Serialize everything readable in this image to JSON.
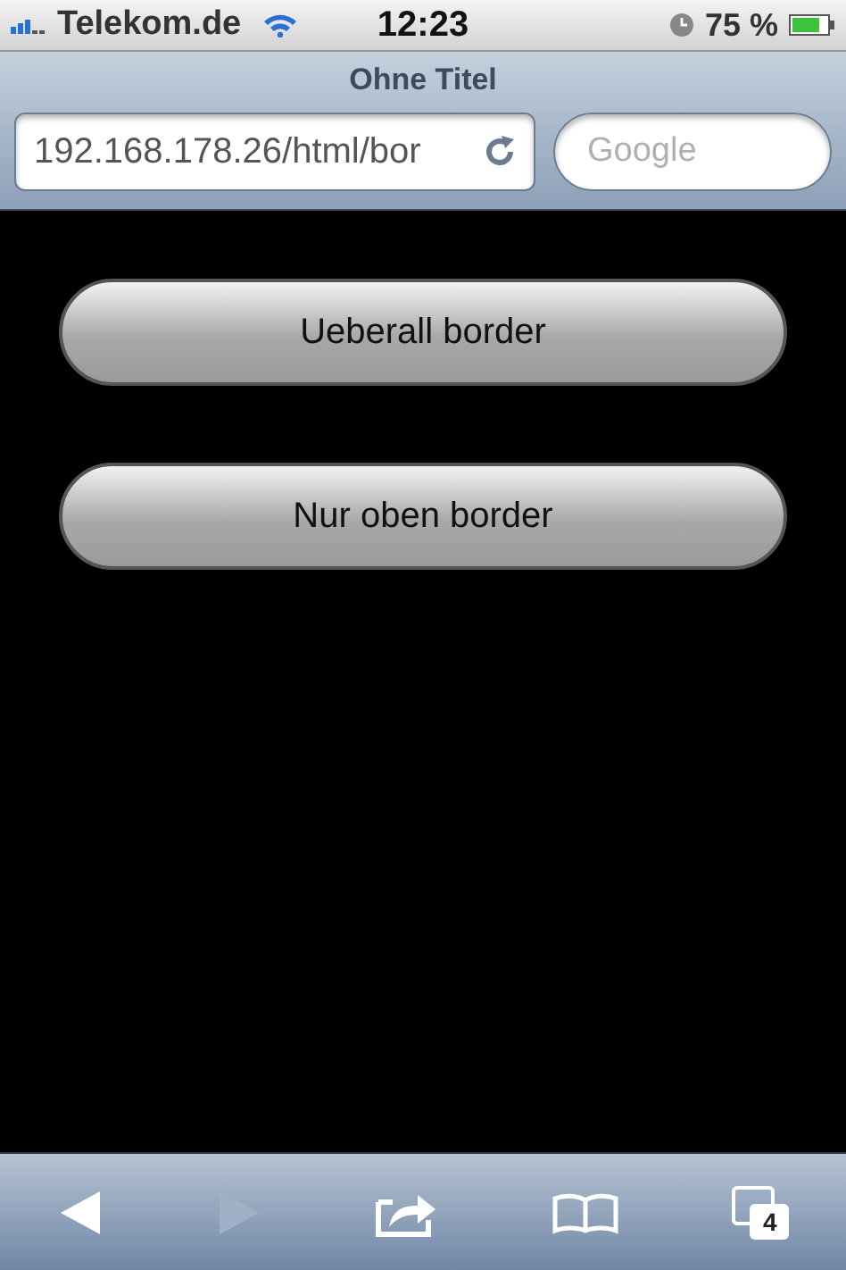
{
  "status_bar": {
    "carrier": "Telekom.de",
    "time": "12:23",
    "battery": "75 %"
  },
  "browser": {
    "title": "Ohne Titel",
    "url": "192.168.178.26/html/bor",
    "search": {
      "placeholder": "Google"
    }
  },
  "page": {
    "buttons": [
      "Ueberall border",
      "Nur oben border"
    ]
  },
  "toolbar": {
    "back_disabled": false,
    "forward_disabled": true,
    "tab_count": "4"
  }
}
